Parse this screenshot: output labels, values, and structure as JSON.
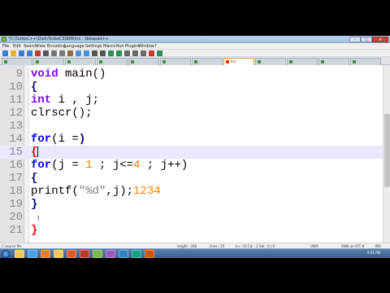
{
  "window": {
    "title": "*C:\\TurboC++\\Disk\\TurboC3\\BIN\\hrs - Notepad++",
    "controls": {
      "minimize": "–",
      "maximize": "□",
      "close": "✕"
    }
  },
  "menu": [
    "File",
    "Edit",
    "Search",
    "View",
    "Encoding",
    "Language",
    "Settings",
    "Macro",
    "Run",
    "Plugins",
    "Window",
    "?"
  ],
  "toolbar": {
    "icons": [
      "new-file-icon",
      "open-file-icon",
      "save-icon",
      "save-all-icon",
      "close-icon",
      "print-icon",
      "cut-icon",
      "copy-icon",
      "paste-icon",
      "undo-icon",
      "redo-icon",
      "find-icon",
      "replace-icon",
      "zoom-in-icon",
      "zoom-out-icon",
      "sync-icon",
      "wrap-icon",
      "indent-guide-icon",
      "macro-record-icon",
      "macro-play-icon"
    ],
    "colors": [
      "#3a7bd5",
      "#e6b422",
      "#3a7bd5",
      "#3a7bd5",
      "#c0392b",
      "#555555",
      "#777777",
      "#777777",
      "#8e6b3a",
      "#4a90d9",
      "#4a90d9",
      "#555555",
      "#555555",
      "#2e8b57",
      "#2e8b57",
      "#666666",
      "#666666",
      "#666666",
      "#c0392b",
      "#2e8b57"
    ]
  },
  "tabs": [
    {
      "label": "",
      "active": false,
      "modified": false
    },
    {
      "label": "",
      "active": false,
      "modified": false
    },
    {
      "label": "",
      "active": false,
      "modified": false
    },
    {
      "label": "",
      "active": false,
      "modified": false
    },
    {
      "label": "",
      "active": false,
      "modified": false
    },
    {
      "label": "",
      "active": false,
      "modified": false
    },
    {
      "label": "",
      "active": false,
      "modified": false
    },
    {
      "label": "hrs",
      "active": true,
      "modified": true
    },
    {
      "label": "",
      "active": false,
      "modified": false
    },
    {
      "label": "",
      "active": false,
      "modified": false
    },
    {
      "label": "",
      "active": false,
      "modified": false
    },
    {
      "label": "",
      "active": false,
      "modified": false
    }
  ],
  "editor": {
    "current_line": 15,
    "lines": [
      {
        "num": "9",
        "tokens": [
          [
            "kw-type",
            "void"
          ],
          [
            "plain",
            " main()"
          ]
        ]
      },
      {
        "num": "10",
        "tokens": [
          [
            "op",
            "{"
          ]
        ]
      },
      {
        "num": "11",
        "tokens": [
          [
            "kw-type",
            "int"
          ],
          [
            "plain",
            " i , j;"
          ]
        ]
      },
      {
        "num": "12",
        "tokens": [
          [
            "plain",
            "clrscr();"
          ]
        ]
      },
      {
        "num": "13",
        "tokens": []
      },
      {
        "num": "14",
        "tokens": [
          [
            "kw",
            "for"
          ],
          [
            "plain",
            "(i ="
          ],
          [
            "op",
            ")"
          ]
        ]
      },
      {
        "num": "15",
        "tokens": [
          [
            "brace-red",
            "{"
          ]
        ]
      },
      {
        "num": "16",
        "tokens": [
          [
            "kw",
            "for"
          ],
          [
            "plain",
            "(j = "
          ],
          [
            "num",
            "1"
          ],
          [
            "plain",
            " ; j<="
          ],
          [
            "num",
            "4"
          ],
          [
            "plain",
            " ; j++)"
          ]
        ]
      },
      {
        "num": "17",
        "tokens": [
          [
            "op",
            "{"
          ]
        ]
      },
      {
        "num": "18",
        "tokens": [
          [
            "plain",
            "printf("
          ],
          [
            "str",
            "\"%d\""
          ],
          [
            "plain",
            ",j);"
          ],
          [
            "num",
            "1234"
          ]
        ]
      },
      {
        "num": "19",
        "tokens": [
          [
            "op",
            "}"
          ]
        ]
      },
      {
        "num": "20",
        "tokens": []
      },
      {
        "num": "21",
        "tokens": [
          [
            "brace-red",
            "}"
          ]
        ]
      }
    ]
  },
  "status": {
    "file_type": "C source file",
    "length": "length : 260",
    "lines": "lines : 25",
    "position": "Ln : 15   Col : 2   Sel : 0 | 0",
    "eol": "UNIX",
    "encoding": "ANSI as UTF-8",
    "mode": "INS"
  },
  "taskbar": {
    "icons": [
      "explorer-icon",
      "browser-icon",
      "media-player-icon",
      "folder-icon",
      "firefox-icon",
      "recorder-icon",
      "notepadpp-icon",
      "app-icon",
      "app-icon",
      "app-icon",
      "app-icon"
    ],
    "colors": [
      "#f2c94c",
      "#4aa3df",
      "#e67e22",
      "#f2c94c",
      "#e8572a",
      "#c0392b",
      "#7fb24a",
      "#9b59b6",
      "#2e86c1",
      "#16a085",
      "#d35400"
    ],
    "clock": "9:51 PM"
  }
}
